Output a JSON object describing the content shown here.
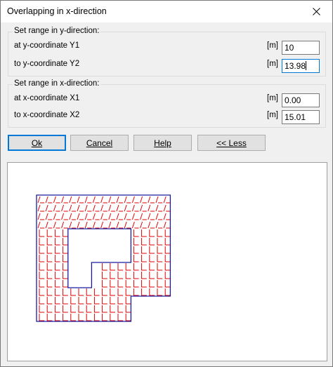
{
  "window": {
    "title": "Overlapping in x-direction",
    "close_icon": "close-icon"
  },
  "y_group": {
    "legend": "Set range in y-direction:",
    "y1_label": "at y-coordinate Y1",
    "y1_unit": "[m]",
    "y1_value": "10",
    "y2_label": "to y-coordinate Y2",
    "y2_unit": "[m]",
    "y2_value": "13.98"
  },
  "x_group": {
    "legend": "Set range in x-direction:",
    "x1_label": "at x-coordinate X1",
    "x1_unit": "[m]",
    "x1_value": "0.00",
    "x2_label": "to x-coordinate X2",
    "x2_unit": "[m]",
    "x2_value": "15.01"
  },
  "buttons": {
    "ok_label": "Ok",
    "cancel_label": "Cancel",
    "help_label": "Help",
    "less_label": "<< Less"
  },
  "preview": {
    "outline_color": "#1a1aa0",
    "grid_color": "#e00000"
  }
}
